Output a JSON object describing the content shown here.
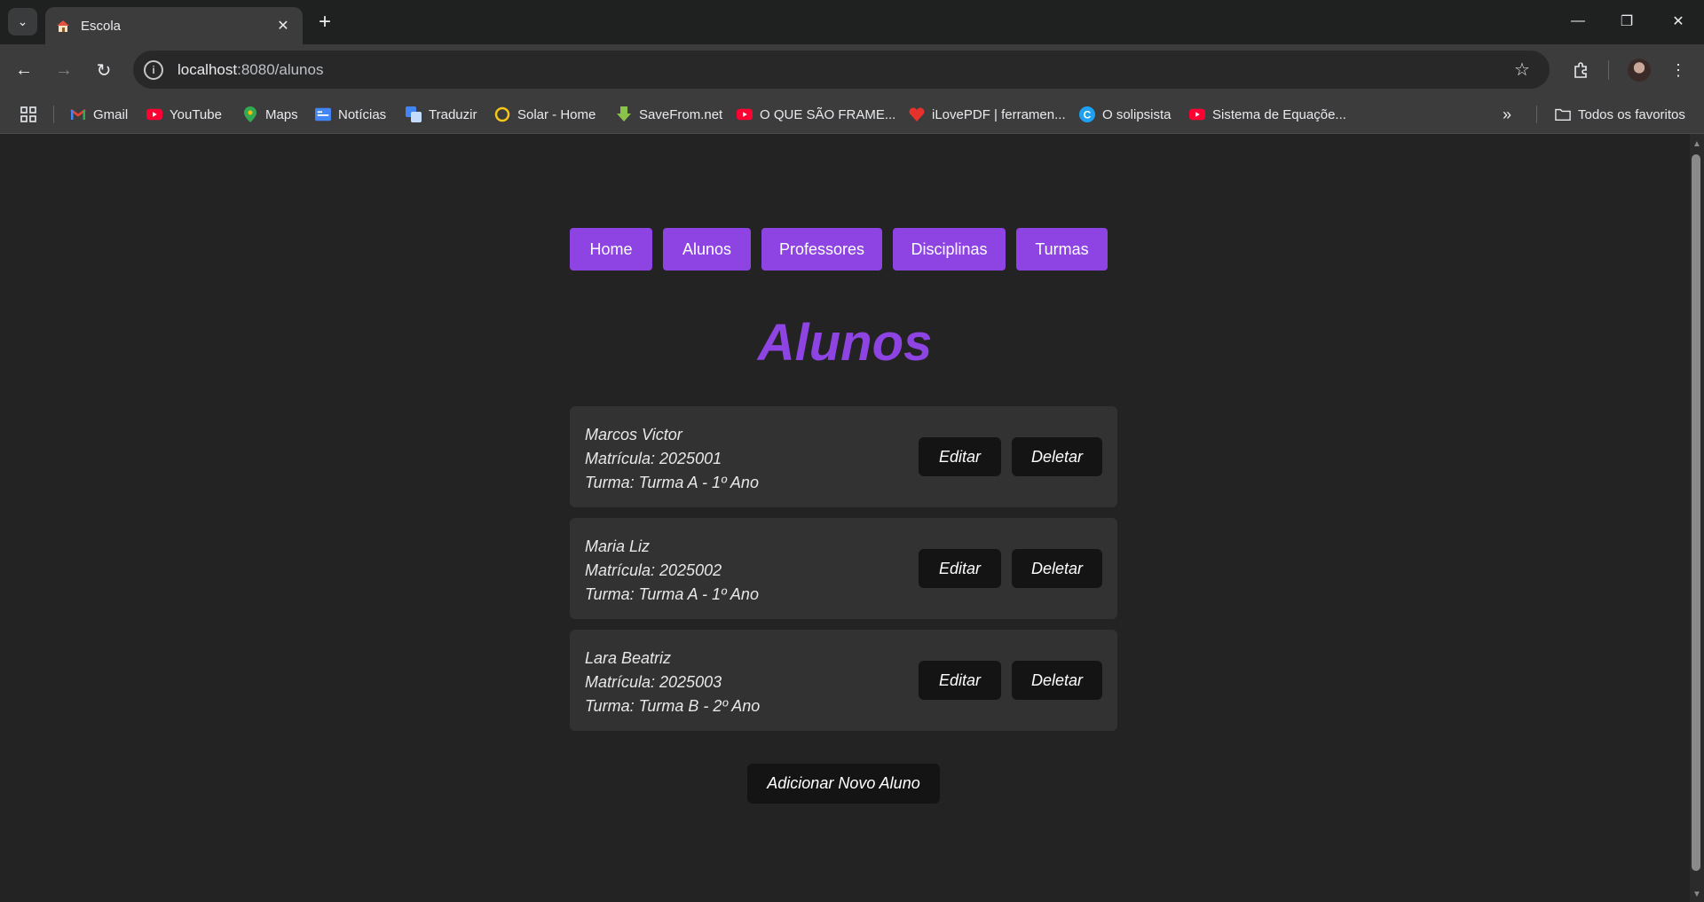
{
  "browser": {
    "tab_title": "Escola",
    "url_host": "localhost",
    "url_path": ":8080/alunos",
    "bookmarks": [
      {
        "label": "Gmail"
      },
      {
        "label": "YouTube"
      },
      {
        "label": "Maps"
      },
      {
        "label": "Notícias"
      },
      {
        "label": "Traduzir"
      },
      {
        "label": "Solar - Home"
      },
      {
        "label": "SaveFrom.net"
      },
      {
        "label": "O QUE SÃO FRAME..."
      },
      {
        "label": "iLovePDF | ferramen..."
      },
      {
        "label": "O solipsista"
      },
      {
        "label": "Sistema de Equaçõe..."
      }
    ],
    "all_bookmarks": "Todos os favoritos"
  },
  "nav": {
    "items": [
      {
        "label": "Home"
      },
      {
        "label": "Alunos"
      },
      {
        "label": "Professores"
      },
      {
        "label": "Disciplinas"
      },
      {
        "label": "Turmas"
      }
    ]
  },
  "page": {
    "title": "Alunos",
    "students": [
      {
        "name": "Marcos Victor",
        "matricula": "Matrícula: 2025001",
        "turma": "Turma: Turma A - 1º Ano",
        "edit": "Editar",
        "delete": "Deletar"
      },
      {
        "name": "Maria Liz",
        "matricula": "Matrícula: 2025002",
        "turma": "Turma: Turma A - 1º Ano",
        "edit": "Editar",
        "delete": "Deletar"
      },
      {
        "name": "Lara Beatriz",
        "matricula": "Matrícula: 2025003",
        "turma": "Turma: Turma B - 2º Ano",
        "edit": "Editar",
        "delete": "Deletar"
      }
    ],
    "add_button": "Adicionar Novo Aluno"
  },
  "colors": {
    "accent": "#8e44e2",
    "background": "#232323",
    "card": "#323232",
    "button_dark": "#141414"
  }
}
